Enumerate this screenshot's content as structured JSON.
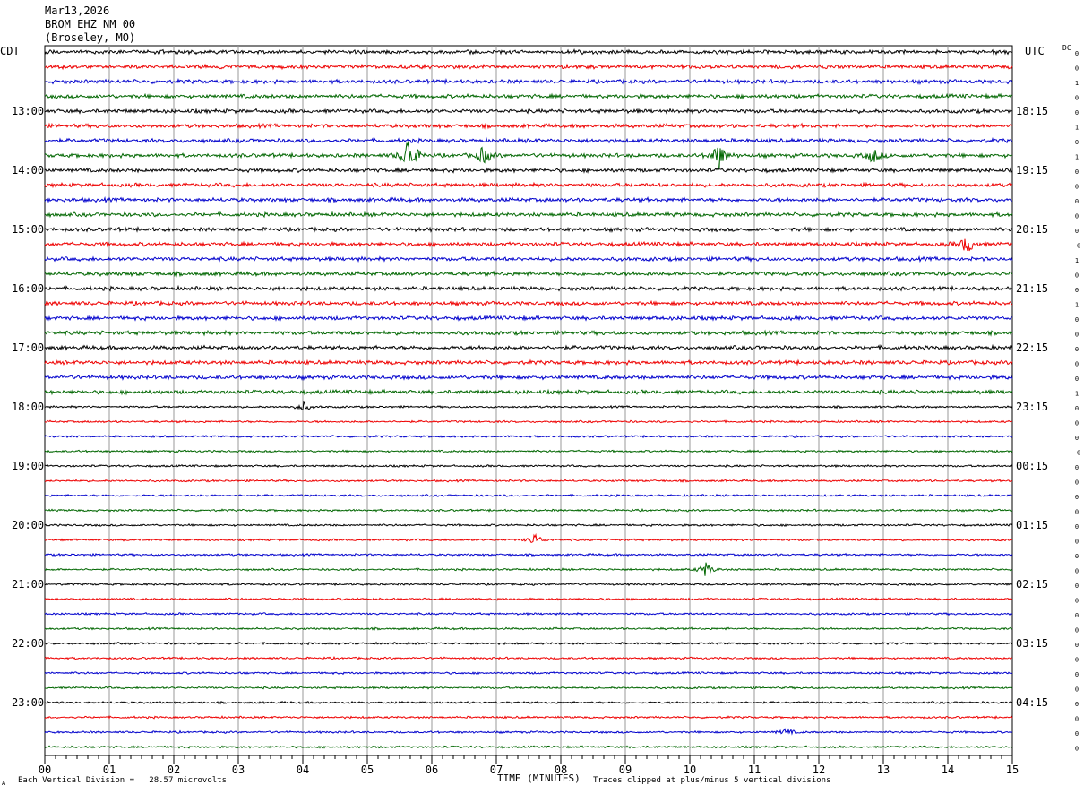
{
  "header": {
    "date": "Mar13,2026",
    "station": "BROM EHZ NM 00",
    "location": "(Broseley, MO)"
  },
  "left_label": "CDT",
  "right_label": "UTC",
  "dc_label": "DC",
  "xlabel": "TIME (MINUTES)",
  "footer": {
    "left_mark": "A",
    "scale_text": "Each Vertical Division =   28.57 microvolts",
    "clip_text": "Traces clipped at plus/minus 5 vertical divisions"
  },
  "chart_data": {
    "type": "line",
    "title": "",
    "xlabel": "TIME (MINUTES)",
    "xlim": [
      0,
      15
    ],
    "x_ticks": [
      "00",
      "01",
      "02",
      "03",
      "04",
      "05",
      "06",
      "07",
      "08",
      "09",
      "10",
      "11",
      "12",
      "13",
      "14",
      "15"
    ],
    "trace_count": 48,
    "trace_interval_minutes": 15,
    "trace_colors": [
      "#000000",
      "#ee0000",
      "#0000cc",
      "#006600"
    ],
    "left_time_labels": [
      {
        "trace": 4,
        "text": "13:00"
      },
      {
        "trace": 8,
        "text": "14:00"
      },
      {
        "trace": 12,
        "text": "15:00"
      },
      {
        "trace": 16,
        "text": "16:00"
      },
      {
        "trace": 20,
        "text": "17:00"
      },
      {
        "trace": 24,
        "text": "18:00"
      },
      {
        "trace": 28,
        "text": "19:00"
      },
      {
        "trace": 32,
        "text": "20:00"
      },
      {
        "trace": 36,
        "text": "21:00"
      },
      {
        "trace": 40,
        "text": "22:00"
      },
      {
        "trace": 44,
        "text": "23:00"
      }
    ],
    "right_time_labels": [
      {
        "trace": 4,
        "text": "18:15"
      },
      {
        "trace": 8,
        "text": "19:15"
      },
      {
        "trace": 12,
        "text": "20:15"
      },
      {
        "trace": 16,
        "text": "21:15"
      },
      {
        "trace": 20,
        "text": "22:15"
      },
      {
        "trace": 24,
        "text": "23:15"
      },
      {
        "trace": 28,
        "text": "00:15"
      },
      {
        "trace": 32,
        "text": "01:15"
      },
      {
        "trace": 36,
        "text": "02:15"
      },
      {
        "trace": 40,
        "text": "03:15"
      },
      {
        "trace": 44,
        "text": "04:15"
      }
    ],
    "dc_offsets": [
      "0",
      "0",
      "1",
      "0",
      "0",
      "1",
      "0",
      "1",
      "0",
      "0",
      "0",
      "0",
      "0",
      "-0",
      "1",
      "0",
      "0",
      "1",
      "0",
      "0",
      "0",
      "0",
      "0",
      "1",
      "0",
      "0",
      "0",
      "-0",
      "0",
      "0",
      "0",
      "0",
      "0",
      "0",
      "0",
      "0",
      "0",
      "0",
      "0",
      "0",
      "0",
      "0",
      "0",
      "0",
      "0",
      "0",
      "0",
      "0"
    ],
    "events": [
      {
        "trace": 7,
        "minute": 5.65,
        "amplitude": 1.0
      },
      {
        "trace": 7,
        "minute": 6.8,
        "amplitude": 0.4
      },
      {
        "trace": 7,
        "minute": 10.45,
        "amplitude": 0.6
      },
      {
        "trace": 7,
        "minute": 12.85,
        "amplitude": 0.3
      },
      {
        "trace": 13,
        "minute": 14.3,
        "amplitude": 0.4
      },
      {
        "trace": 24,
        "minute": 4.0,
        "amplitude": 0.2
      },
      {
        "trace": 33,
        "minute": 7.6,
        "amplitude": 0.25
      },
      {
        "trace": 35,
        "minute": 10.25,
        "amplitude": 0.3
      },
      {
        "trace": 46,
        "minute": 11.5,
        "amplitude": 0.15
      }
    ]
  }
}
